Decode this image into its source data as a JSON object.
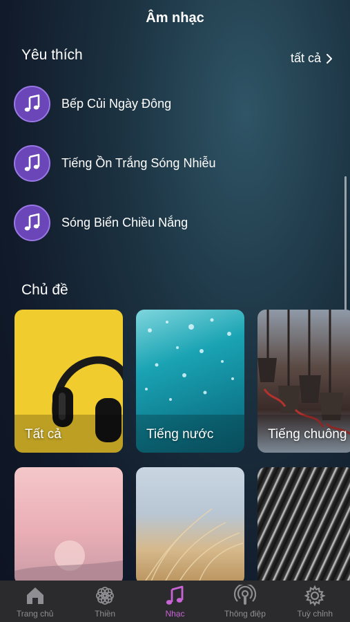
{
  "header": {
    "title": "Âm nhạc"
  },
  "favorites": {
    "title": "Yêu thích",
    "see_all": "tất cả",
    "items": [
      {
        "label": "Bếp Củi Ngày Đông",
        "icon": "music-note-icon"
      },
      {
        "label": "Tiếng Ồn Trắng Sóng Nhiễu",
        "icon": "music-note-icon"
      },
      {
        "label": "Sóng Biển Chiều Nắng",
        "icon": "music-note-icon"
      }
    ]
  },
  "topics": {
    "title": "Chủ đề",
    "cards": [
      {
        "label": "Tất cả",
        "image": "headphones-on-yellow"
      },
      {
        "label": "Tiếng nước",
        "image": "water-bubbles"
      },
      {
        "label": "Tiếng chuông",
        "image": "hanging-bells"
      },
      {
        "label": "",
        "image": "pink-sunset"
      },
      {
        "label": "",
        "image": "dry-grass"
      },
      {
        "label": "",
        "image": "rain-streaks"
      }
    ]
  },
  "tabbar": {
    "tabs": [
      {
        "label": "Trang chủ",
        "icon": "home-icon",
        "active": false
      },
      {
        "label": "Thiền",
        "icon": "lotus-icon",
        "active": false
      },
      {
        "label": "Nhạc",
        "icon": "music-note-icon",
        "active": true
      },
      {
        "label": "Thông điệp",
        "icon": "podcast-icon",
        "active": false
      },
      {
        "label": "Tuỳ chỉnh",
        "icon": "gear-icon",
        "active": false
      }
    ]
  },
  "colors": {
    "accent": "#c964d6",
    "note_circle": "#6a46b8",
    "tabbar_bg": "#2b2b2d"
  }
}
